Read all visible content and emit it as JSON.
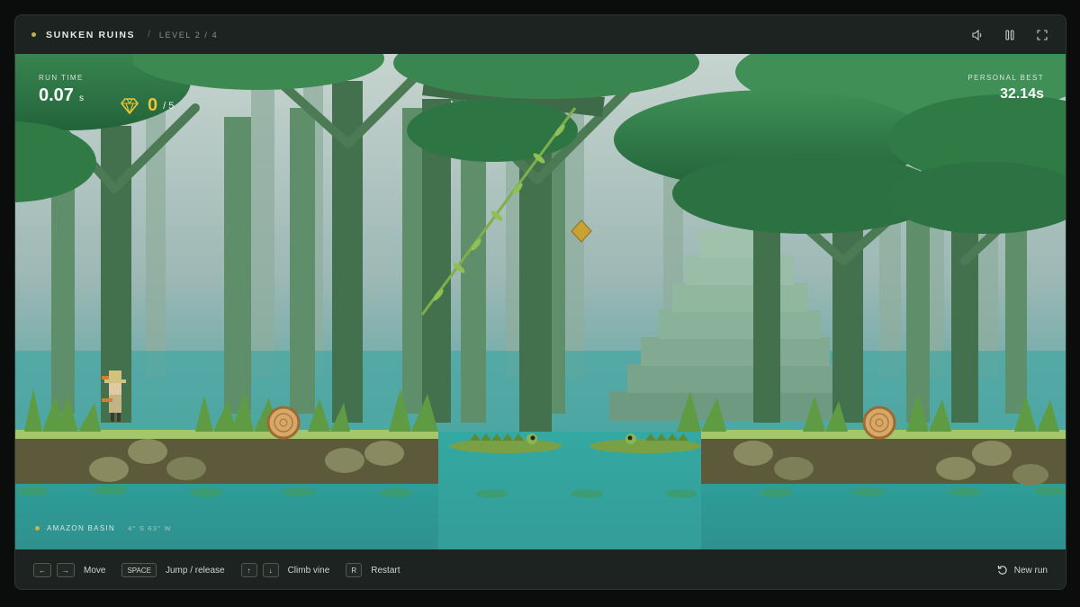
{
  "header": {
    "level_name": "SUNKEN RUINS",
    "separator": "/",
    "level_progress": "LEVEL 2 / 4",
    "icons": [
      "volume-icon",
      "pause-icon",
      "fullscreen-icon"
    ]
  },
  "hud": {
    "run_time_label": "RUN TIME",
    "run_time_value": "0.07",
    "run_time_unit": "s",
    "gems_collected": "0",
    "gems_total": "/ 5",
    "personal_best_label": "PERSONAL BEST",
    "personal_best_value": "32.14s"
  },
  "location": {
    "name": "AMAZON BASIN",
    "coords": "4° S   63° W"
  },
  "controls": [
    {
      "keys": [
        "←",
        "→"
      ],
      "label": "Move"
    },
    {
      "keys": [
        "SPACE"
      ],
      "label": "Jump / release"
    },
    {
      "keys": [
        "↑",
        "↓"
      ],
      "label": "Climb vine"
    },
    {
      "keys": [
        "R"
      ],
      "label": "Restart"
    }
  ],
  "new_run_label": "New run",
  "colors": {
    "accent_gold": "#e8c437",
    "frame_bg": "#1d2320",
    "water": "#2a9a95",
    "grass": "#a6c66b",
    "foliage": "#2f7a45"
  }
}
